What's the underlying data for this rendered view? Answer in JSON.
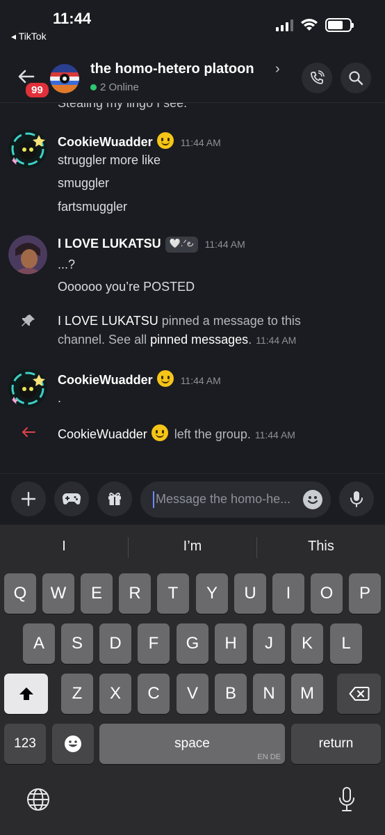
{
  "status": {
    "time": "11:44",
    "back_app": "◂ TikTok"
  },
  "header": {
    "badge": "99",
    "title": "the homo-hetero platoon",
    "online": "2 Online"
  },
  "messages": {
    "cut_text": "Stealing my lingo I see.",
    "m1": {
      "user": "CookieWuadder",
      "time": "11:44 AM",
      "lines": [
        "struggler more like",
        "smuggler",
        "fartsmuggler"
      ]
    },
    "m2": {
      "user": "I LOVE LUKATSU",
      "tag": "🤍.ᐟ౿",
      "time": "11:44 AM",
      "lines": [
        "...?",
        "Oooooo you’re POSTED"
      ]
    },
    "pin": {
      "actor": "I LOVE LUKATSU",
      "text1": " pinned a message to this",
      "text2": "channel. See all ",
      "link": "pinned messages",
      "text3": ".",
      "time": "11:44 AM"
    },
    "m3": {
      "user": "CookieWuadder",
      "time": "11:44 AM",
      "lines": [
        "."
      ]
    },
    "leave": {
      "actor": "CookieWuadder",
      "text": " left the group.",
      "time": "11:44 AM"
    }
  },
  "composer": {
    "placeholder": "Message the homo-he..."
  },
  "keyboard": {
    "suggestions": [
      "I",
      "I’m",
      "This"
    ],
    "row1": [
      "Q",
      "W",
      "E",
      "R",
      "T",
      "Y",
      "U",
      "I",
      "O",
      "P"
    ],
    "row2": [
      "A",
      "S",
      "D",
      "F",
      "G",
      "H",
      "J",
      "K",
      "L"
    ],
    "row3": [
      "Z",
      "X",
      "C",
      "V",
      "B",
      "N",
      "M"
    ],
    "numbers": "123",
    "space": "space",
    "space_langs": "EN DE",
    "return": "return"
  }
}
